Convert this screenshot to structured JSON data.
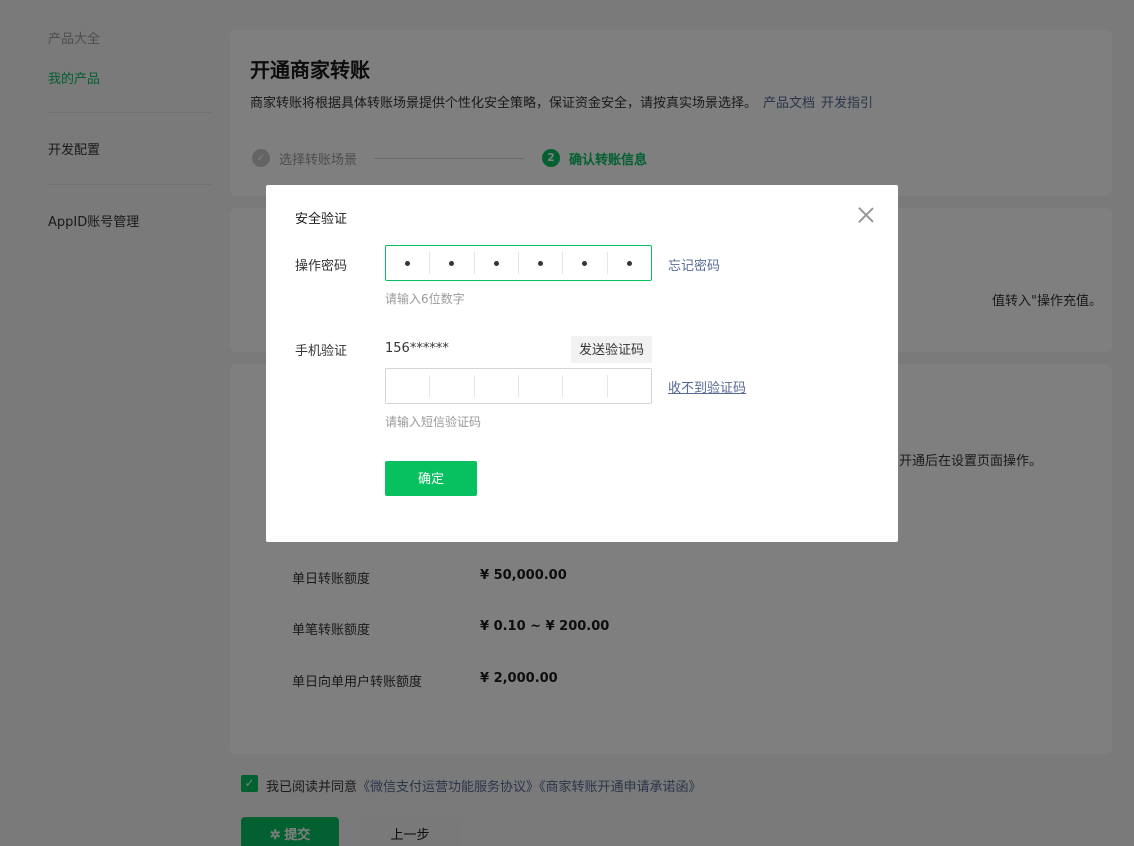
{
  "sidebar": {
    "section_title": "产品大全",
    "items": [
      {
        "label": "我的产品"
      },
      {
        "label": "开发配置"
      },
      {
        "label": "AppID账号管理"
      }
    ]
  },
  "main": {
    "title": "开通商家转账",
    "description": "商家转账将根据具体转账场景提供个性化安全策略，保证资金安全，请按真实场景选择。",
    "doc_link": "产品文档",
    "dev_link": "开发指引",
    "steps": [
      {
        "label": "选择转账场景",
        "state": "done"
      },
      {
        "num": "2",
        "label": "确认转账信息",
        "state": "current"
      }
    ],
    "card2_fragment": "值转入\"操作充值。",
    "card3_fragment": "开通后在设置页面操作。",
    "limits": [
      {
        "label": "单日转账额度",
        "value": "¥ 50,000.00"
      },
      {
        "label": "单笔转账额度",
        "value": "¥ 0.10 ~ ¥ 200.00"
      },
      {
        "label": "单日向单用户转账额度",
        "value": "¥ 2,000.00"
      }
    ],
    "agreement": {
      "checked": true,
      "prefix": "我已阅读并同意",
      "link1": "《微信支付运营功能服务协议》",
      "link2": "《商家转账开通申请承诺函》"
    },
    "submit_label": "提交",
    "prev_label": "上一步"
  },
  "dialog": {
    "title": "安全验证",
    "password_label": "操作密码",
    "password_digits_filled": 6,
    "password_hint": "请输入6位数字",
    "forgot_link": "忘记密码",
    "phone_label": "手机验证",
    "phone_number": "156******",
    "send_code_label": "发送验证码",
    "sms_hint": "请输入短信验证码",
    "no_code_link": "收不到验证码",
    "confirm_label": "确定"
  },
  "colors": {
    "accent": "#07c160",
    "link": "#576b95"
  }
}
